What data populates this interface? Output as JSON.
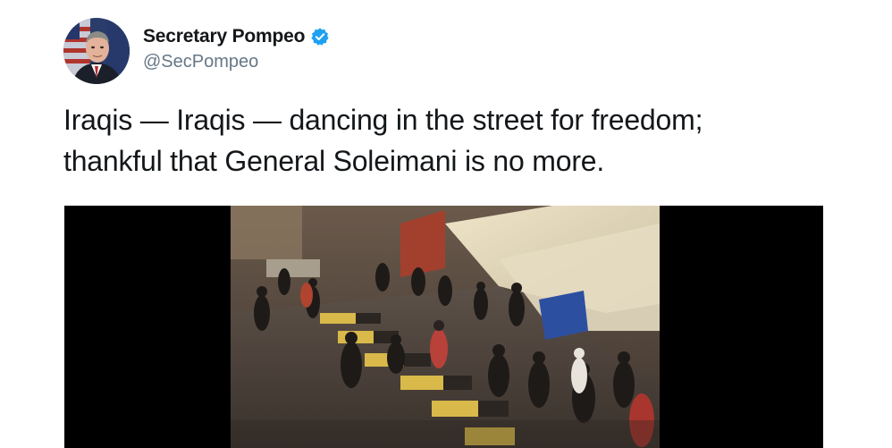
{
  "author": {
    "display_name": "Secretary Pompeo",
    "handle": "@SecPompeo",
    "verified": true,
    "avatar_icon": "profile-photo-icon",
    "verified_icon": "verified-badge-icon"
  },
  "tweet": {
    "text_line_1": "Iraqis — Iraqis — dancing in the street for freedom;",
    "text_line_2": "thankful that General Soleimani is no more."
  },
  "media": {
    "type": "video",
    "thumbnail_icon": "video-thumbnail-icon"
  },
  "colors": {
    "name": "#14171a",
    "handle": "#657786",
    "verified_blue": "#1da1f2",
    "media_background": "#000000"
  }
}
